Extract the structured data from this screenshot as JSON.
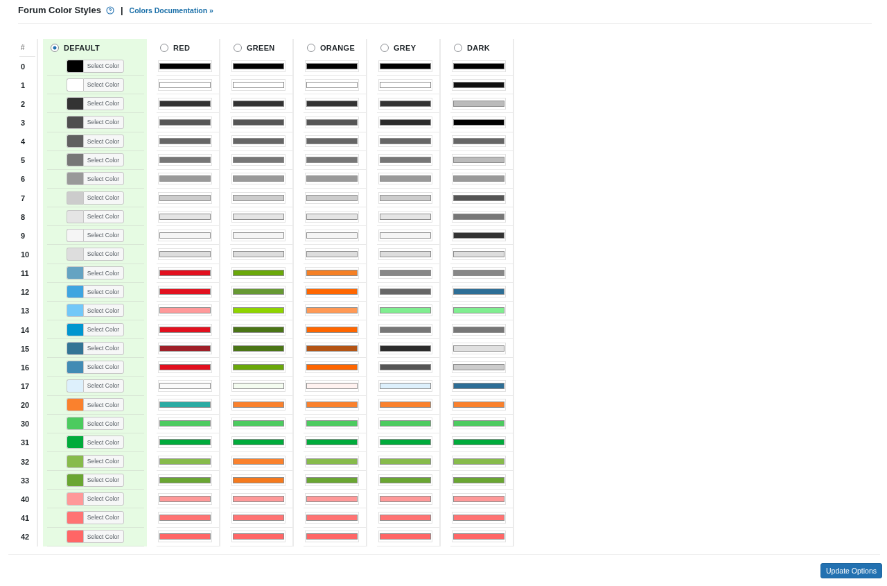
{
  "section": {
    "title": "Forum Color Styles",
    "separator": "|",
    "link": "Colors Documentation »"
  },
  "table": {
    "index_heading": "#",
    "schemes": [
      {
        "name": "DEFAULT",
        "selected": true
      },
      {
        "name": "RED",
        "selected": false
      },
      {
        "name": "GREEN",
        "selected": false
      },
      {
        "name": "ORANGE",
        "selected": false
      },
      {
        "name": "GREY",
        "selected": false
      },
      {
        "name": "DARK",
        "selected": false
      }
    ],
    "rows": [
      {
        "index": "0",
        "cells": [
          {
            "kind": "picker",
            "color": "#000000",
            "button": "Select Color"
          },
          {
            "kind": "preview",
            "color": "#000000"
          },
          {
            "kind": "preview",
            "color": "#000000"
          },
          {
            "kind": "preview",
            "color": "#000000"
          },
          {
            "kind": "preview",
            "color": "#000000"
          },
          {
            "kind": "preview",
            "color": "#000000"
          }
        ]
      },
      {
        "index": "1",
        "cells": [
          {
            "kind": "picker",
            "color": "#ffffff",
            "button": "Select Color"
          },
          {
            "kind": "preview",
            "color": "#ffffff"
          },
          {
            "kind": "preview",
            "color": "#ffffff"
          },
          {
            "kind": "preview",
            "color": "#ffffff"
          },
          {
            "kind": "preview",
            "color": "#ffffff"
          },
          {
            "kind": "preview",
            "color": "#111111"
          }
        ]
      },
      {
        "index": "2",
        "cells": [
          {
            "kind": "picker",
            "color": "#333333",
            "button": "Select Color"
          },
          {
            "kind": "preview",
            "color": "#333333"
          },
          {
            "kind": "preview",
            "color": "#333333"
          },
          {
            "kind": "preview",
            "color": "#333333"
          },
          {
            "kind": "preview",
            "color": "#333333"
          },
          {
            "kind": "preview",
            "color": "#bbbbbb"
          }
        ]
      },
      {
        "index": "3",
        "cells": [
          {
            "kind": "picker",
            "color": "#4f4f4f",
            "button": "Select Color"
          },
          {
            "kind": "preview",
            "color": "#555555"
          },
          {
            "kind": "preview",
            "color": "#555555"
          },
          {
            "kind": "preview",
            "color": "#555555"
          },
          {
            "kind": "preview",
            "color": "#2b2b2b"
          },
          {
            "kind": "preview",
            "color": "#000000"
          }
        ]
      },
      {
        "index": "4",
        "cells": [
          {
            "kind": "picker",
            "color": "#606060",
            "button": "Select Color"
          },
          {
            "kind": "preview",
            "color": "#666666"
          },
          {
            "kind": "preview",
            "color": "#666666"
          },
          {
            "kind": "preview",
            "color": "#666666"
          },
          {
            "kind": "preview",
            "color": "#666666"
          },
          {
            "kind": "preview",
            "color": "#666666"
          }
        ]
      },
      {
        "index": "5",
        "cells": [
          {
            "kind": "picker",
            "color": "#777777",
            "button": "Select Color"
          },
          {
            "kind": "preview",
            "color": "#777777"
          },
          {
            "kind": "preview",
            "color": "#777777"
          },
          {
            "kind": "preview",
            "color": "#777777"
          },
          {
            "kind": "preview",
            "color": "#777777"
          },
          {
            "kind": "preview",
            "color": "#bbbbbb"
          }
        ]
      },
      {
        "index": "6",
        "cells": [
          {
            "kind": "picker",
            "color": "#999999",
            "button": "Select Color"
          },
          {
            "kind": "preview",
            "color": "#999999"
          },
          {
            "kind": "preview",
            "color": "#999999"
          },
          {
            "kind": "preview",
            "color": "#999999"
          },
          {
            "kind": "preview",
            "color": "#999999"
          },
          {
            "kind": "preview",
            "color": "#999999"
          }
        ]
      },
      {
        "index": "7",
        "cells": [
          {
            "kind": "picker",
            "color": "#cccccc",
            "button": "Select Color"
          },
          {
            "kind": "preview",
            "color": "#cccccc"
          },
          {
            "kind": "preview",
            "color": "#cccccc"
          },
          {
            "kind": "preview",
            "color": "#cccccc"
          },
          {
            "kind": "preview",
            "color": "#cccccc"
          },
          {
            "kind": "preview",
            "color": "#555555"
          }
        ]
      },
      {
        "index": "8",
        "cells": [
          {
            "kind": "picker",
            "color": "#e5e5e5",
            "button": "Select Color"
          },
          {
            "kind": "preview",
            "color": "#e5e5e5"
          },
          {
            "kind": "preview",
            "color": "#e5e5e5"
          },
          {
            "kind": "preview",
            "color": "#e5e5e5"
          },
          {
            "kind": "preview",
            "color": "#e5e5e5"
          },
          {
            "kind": "preview",
            "color": "#777777"
          }
        ]
      },
      {
        "index": "9",
        "cells": [
          {
            "kind": "picker",
            "color": "#f5f5f5",
            "button": "Select Color"
          },
          {
            "kind": "preview",
            "color": "#f5f5f5"
          },
          {
            "kind": "preview",
            "color": "#f5f5f5"
          },
          {
            "kind": "preview",
            "color": "#f5f5f5"
          },
          {
            "kind": "preview",
            "color": "#f5f5f5"
          },
          {
            "kind": "preview",
            "color": "#333333"
          }
        ]
      },
      {
        "index": "10",
        "cells": [
          {
            "kind": "picker",
            "color": "#dddddd",
            "button": "Select Color"
          },
          {
            "kind": "preview",
            "color": "#dddddd"
          },
          {
            "kind": "preview",
            "color": "#dddddd"
          },
          {
            "kind": "preview",
            "color": "#dddddd"
          },
          {
            "kind": "preview",
            "color": "#dddddd"
          },
          {
            "kind": "preview",
            "color": "#dddddd"
          }
        ]
      },
      {
        "index": "11",
        "cells": [
          {
            "kind": "picker",
            "color": "#65a3c2",
            "button": "Select Color"
          },
          {
            "kind": "preview",
            "color": "#e2101f"
          },
          {
            "kind": "preview",
            "color": "#6aa80a"
          },
          {
            "kind": "preview",
            "color": "#f58025"
          },
          {
            "kind": "preview",
            "color": "#888888"
          },
          {
            "kind": "preview",
            "color": "#888888"
          }
        ]
      },
      {
        "index": "12",
        "cells": [
          {
            "kind": "picker",
            "color": "#3ea5e0",
            "button": "Select Color"
          },
          {
            "kind": "preview",
            "color": "#e2101f"
          },
          {
            "kind": "preview",
            "color": "#669933"
          },
          {
            "kind": "preview",
            "color": "#ff6600"
          },
          {
            "kind": "preview",
            "color": "#666666"
          },
          {
            "kind": "preview",
            "color": "#2d6e96"
          }
        ]
      },
      {
        "index": "13",
        "cells": [
          {
            "kind": "picker",
            "color": "#72c8f8",
            "button": "Select Color"
          },
          {
            "kind": "preview",
            "color": "#ff999a"
          },
          {
            "kind": "preview",
            "color": "#8fd400"
          },
          {
            "kind": "preview",
            "color": "#ff9955"
          },
          {
            "kind": "preview",
            "color": "#80ee90"
          },
          {
            "kind": "preview",
            "color": "#80ee90"
          }
        ]
      },
      {
        "index": "14",
        "cells": [
          {
            "kind": "picker",
            "color": "#0096cf",
            "button": "Select Color"
          },
          {
            "kind": "preview",
            "color": "#e2101f"
          },
          {
            "kind": "preview",
            "color": "#4a7516"
          },
          {
            "kind": "preview",
            "color": "#ff6600"
          },
          {
            "kind": "preview",
            "color": "#777777"
          },
          {
            "kind": "preview",
            "color": "#777777"
          }
        ]
      },
      {
        "index": "15",
        "cells": [
          {
            "kind": "picker",
            "color": "#337595",
            "button": "Select Color"
          },
          {
            "kind": "preview",
            "color": "#9e1f28"
          },
          {
            "kind": "preview",
            "color": "#4a7516"
          },
          {
            "kind": "preview",
            "color": "#b35414"
          },
          {
            "kind": "preview",
            "color": "#2b2b2b"
          },
          {
            "kind": "preview",
            "color": "#e0e0e0"
          }
        ]
      },
      {
        "index": "16",
        "cells": [
          {
            "kind": "picker",
            "color": "#428bb4",
            "button": "Select Color"
          },
          {
            "kind": "preview",
            "color": "#e2101f"
          },
          {
            "kind": "preview",
            "color": "#6aa80a"
          },
          {
            "kind": "preview",
            "color": "#ff6600"
          },
          {
            "kind": "preview",
            "color": "#555555"
          },
          {
            "kind": "preview",
            "color": "#cccccc"
          }
        ]
      },
      {
        "index": "17",
        "cells": [
          {
            "kind": "picker",
            "color": "#ddf0fc",
            "button": "Select Color"
          },
          {
            "kind": "preview",
            "color": "#fafafa"
          },
          {
            "kind": "preview",
            "color": "#f4fcf0"
          },
          {
            "kind": "preview",
            "color": "#fff2f0"
          },
          {
            "kind": "preview",
            "color": "#ddf0fc"
          },
          {
            "kind": "preview",
            "color": "#2d6e96"
          }
        ]
      },
      {
        "index": "20",
        "cells": [
          {
            "kind": "picker",
            "color": "#fa812d",
            "button": "Select Color"
          },
          {
            "kind": "preview",
            "color": "#2baba3"
          },
          {
            "kind": "preview",
            "color": "#fa812d"
          },
          {
            "kind": "preview",
            "color": "#fa812d"
          },
          {
            "kind": "preview",
            "color": "#fa812d"
          },
          {
            "kind": "preview",
            "color": "#fa812d"
          }
        ]
      },
      {
        "index": "30",
        "cells": [
          {
            "kind": "picker",
            "color": "#4ccb5f",
            "button": "Select Color"
          },
          {
            "kind": "preview",
            "color": "#4ccb5f"
          },
          {
            "kind": "preview",
            "color": "#4ccb5f"
          },
          {
            "kind": "preview",
            "color": "#4ccb5f"
          },
          {
            "kind": "preview",
            "color": "#4ccb5f"
          },
          {
            "kind": "preview",
            "color": "#4ccb5f"
          }
        ]
      },
      {
        "index": "31",
        "cells": [
          {
            "kind": "picker",
            "color": "#00ab3b",
            "button": "Select Color"
          },
          {
            "kind": "preview",
            "color": "#00ab3b"
          },
          {
            "kind": "preview",
            "color": "#00ab3b"
          },
          {
            "kind": "preview",
            "color": "#00ab3b"
          },
          {
            "kind": "preview",
            "color": "#00ab3b"
          },
          {
            "kind": "preview",
            "color": "#00ab3b"
          }
        ]
      },
      {
        "index": "32",
        "cells": [
          {
            "kind": "picker",
            "color": "#87bb4b",
            "button": "Select Color"
          },
          {
            "kind": "preview",
            "color": "#87bb4b"
          },
          {
            "kind": "preview",
            "color": "#fa812d"
          },
          {
            "kind": "preview",
            "color": "#87bb4b"
          },
          {
            "kind": "preview",
            "color": "#87bb4b"
          },
          {
            "kind": "preview",
            "color": "#87bb4b"
          }
        ]
      },
      {
        "index": "33",
        "cells": [
          {
            "kind": "picker",
            "color": "#6aa632",
            "button": "Select Color"
          },
          {
            "kind": "preview",
            "color": "#6aa632"
          },
          {
            "kind": "preview",
            "color": "#f57a1e"
          },
          {
            "kind": "preview",
            "color": "#6aa632"
          },
          {
            "kind": "preview",
            "color": "#6aa632"
          },
          {
            "kind": "preview",
            "color": "#6aa632"
          }
        ]
      },
      {
        "index": "40",
        "cells": [
          {
            "kind": "picker",
            "color": "#ff9999",
            "button": "Select Color"
          },
          {
            "kind": "preview",
            "color": "#ff9999"
          },
          {
            "kind": "preview",
            "color": "#ff9999"
          },
          {
            "kind": "preview",
            "color": "#ff9999"
          },
          {
            "kind": "preview",
            "color": "#ff9999"
          },
          {
            "kind": "preview",
            "color": "#ff9999"
          }
        ]
      },
      {
        "index": "41",
        "cells": [
          {
            "kind": "picker",
            "color": "#ff7373",
            "button": "Select Color"
          },
          {
            "kind": "preview",
            "color": "#ff7373"
          },
          {
            "kind": "preview",
            "color": "#ff7373"
          },
          {
            "kind": "preview",
            "color": "#ff7373"
          },
          {
            "kind": "preview",
            "color": "#ff7373"
          },
          {
            "kind": "preview",
            "color": "#ff7373"
          }
        ]
      },
      {
        "index": "42",
        "cells": [
          {
            "kind": "picker",
            "color": "#ff6666",
            "button": "Select Color"
          },
          {
            "kind": "preview",
            "color": "#ff6666"
          },
          {
            "kind": "preview",
            "color": "#ff6666"
          },
          {
            "kind": "preview",
            "color": "#ff6666"
          },
          {
            "kind": "preview",
            "color": "#ff6666"
          },
          {
            "kind": "preview",
            "color": "#ff6666"
          }
        ]
      }
    ]
  },
  "footer": {
    "button": "Update Options"
  }
}
